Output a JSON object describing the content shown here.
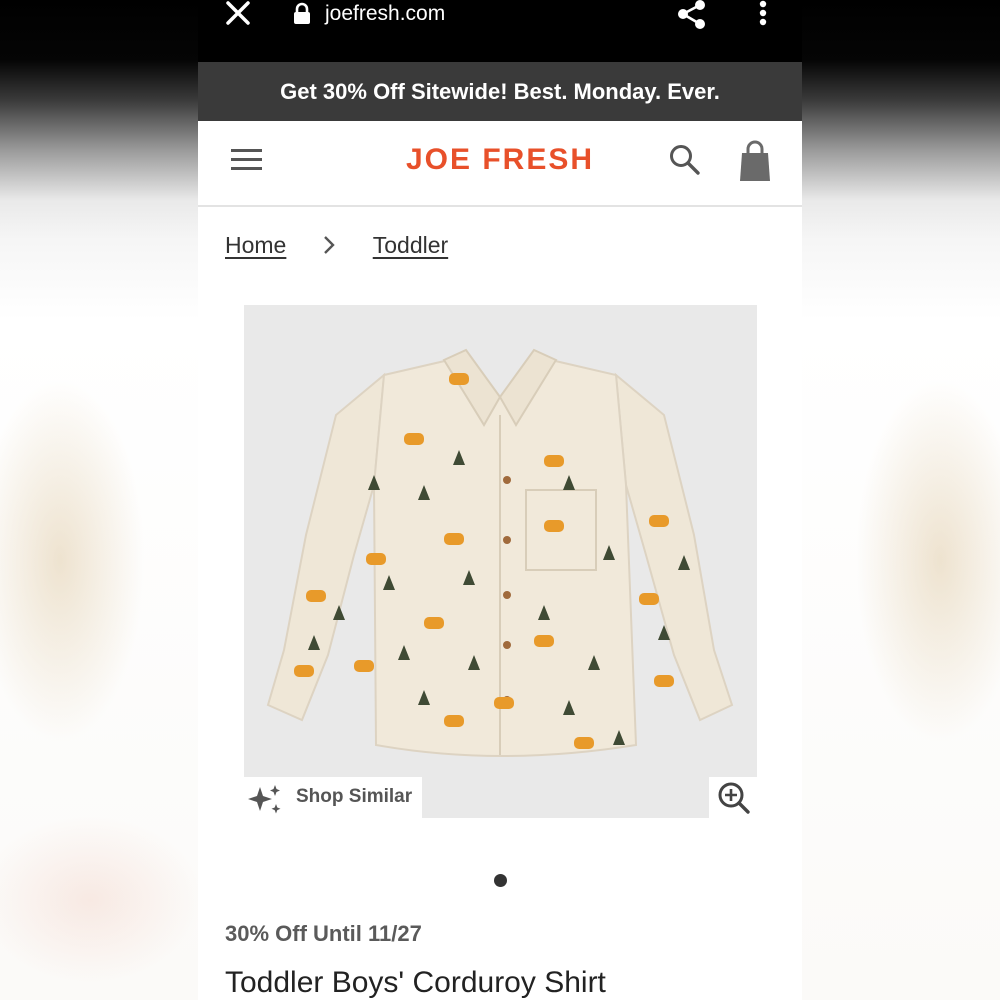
{
  "browser": {
    "url": "joefresh.com",
    "close_icon": "close-icon",
    "lock_icon": "lock-icon",
    "share_icon": "share-icon",
    "menu_icon": "more-vert-icon"
  },
  "promo": {
    "text": "Get 30% Off Sitewide! Best. Monday. Ever."
  },
  "header": {
    "logo": "JOE FRESH",
    "menu_icon": "hamburger-icon",
    "search_icon": "search-icon",
    "bag_icon": "shopping-bag-icon",
    "brand_color": "#e8502a"
  },
  "breadcrumb": {
    "items": [
      "Home",
      "Toddler"
    ],
    "separator_icon": "chevron-right-icon"
  },
  "product": {
    "image_alt": "product-shirt-image",
    "shop_similar_label": "Shop Similar",
    "sparkle_icon": "sparkle-icon",
    "zoom_icon": "zoom-in-icon",
    "carousel_current": 1,
    "carousel_total": 1,
    "sale_text": "30% Off Until 11/27",
    "title": "Toddler Boys' Corduroy Shirt"
  }
}
